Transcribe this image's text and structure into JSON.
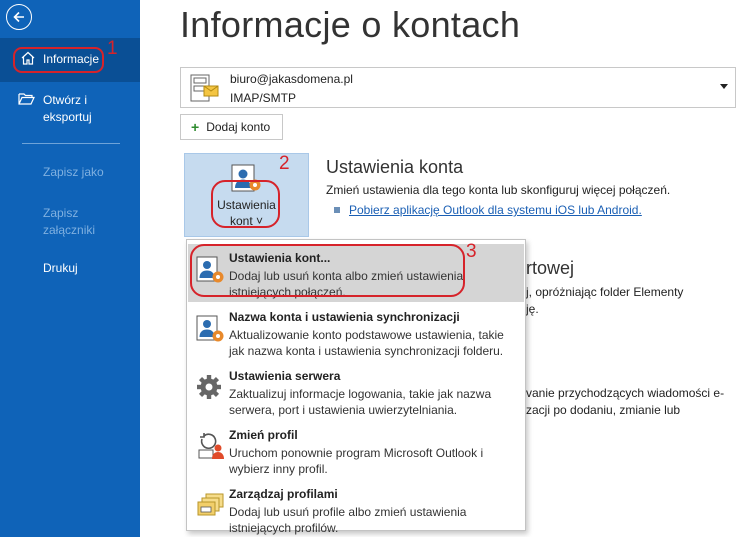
{
  "sidebar": {
    "items": [
      {
        "label": "Informacje"
      },
      {
        "label": "Otwórz i eksportuj"
      },
      {
        "label": "Zapisz jako"
      },
      {
        "label": "Zapisz załączniki"
      },
      {
        "label": "Drukuj"
      }
    ]
  },
  "page": {
    "title": "Informacje o kontach"
  },
  "account": {
    "email": "biuro@jakasdomena.pl",
    "type": "IMAP/SMTP"
  },
  "add_account": {
    "label": "Dodaj konto"
  },
  "settings_tile": {
    "line1": "Ustawienia",
    "line2": "kont ˅"
  },
  "account_settings": {
    "title": "Ustawienia konta",
    "description": "Zmień ustawienia dla tego konta lub skonfiguruj więcej połączeń.",
    "link": "Pobierz aplikację Outlook dla systemu iOS lub Android."
  },
  "background_fragments": {
    "heading_tail": "rtowej",
    "line1": "j, opróżniając folder Elementy",
    "line2": "ję.",
    "line3": "vanie przychodzących wiadomości e-",
    "line4": "zacji po dodaniu, zmianie lub"
  },
  "menu": {
    "items": [
      {
        "title": "Ustawienia kont...",
        "desc": "Dodaj lub usuń konta albo zmień ustawienia istniejących połączeń."
      },
      {
        "title": "Nazwa konta i ustawienia synchronizacji",
        "desc": "Aktualizowanie konto podstawowe ustawienia, takie jak nazwa konta i ustawienia synchronizacji folderu."
      },
      {
        "title": "Ustawienia serwera",
        "desc": "Zaktualizuj informacje logowania, takie jak nazwa serwera, port i ustawienia uwierzytelniania."
      },
      {
        "title": "Zmień profil",
        "desc": "Uruchom ponownie program Microsoft Outlook i wybierz inny profil."
      },
      {
        "title": "Zarządzaj profilami",
        "desc": "Dodaj lub usuń profile albo zmień ustawienia istniejących profilów."
      }
    ]
  },
  "annotations": {
    "n1": "1",
    "n2": "2",
    "n3": "3"
  },
  "colors": {
    "sidebar": "#0f63b8",
    "sidebar_selected": "#0a4f95",
    "annotation": "#d6232a",
    "tile": "#c6dbef",
    "link": "#1a5fb4"
  }
}
